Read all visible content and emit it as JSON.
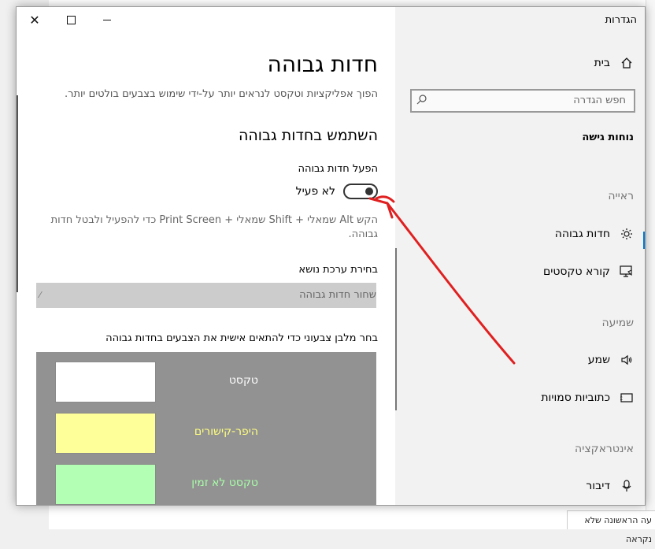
{
  "background": {
    "footer_text": "עה הראשונה שלא נקראה"
  },
  "window": {
    "title": "הגדרות",
    "close_glyph": "✕"
  },
  "nav": {
    "home_label": "בית",
    "search_placeholder": "חפש הגדרה",
    "group_title": "נוחות גישה",
    "categories": {
      "vision": "ראייה",
      "hearing": "שמיעה",
      "interaction": "אינטראקציה"
    },
    "items": {
      "high_contrast": "חדות גבוהה",
      "narrator": "קורא טקסטים",
      "sound": "שמע",
      "captions": "כתוביות סמויות",
      "speech": "דיבור"
    },
    "accent_color": "#0078d7"
  },
  "main": {
    "title": "חדות גבוהה",
    "description": "הפוך אפליקציות וטקסט לנראים יותר על-ידי שימוש בצבעים בולטים יותר.",
    "section_title": "השתמש בחדות גבוהה",
    "toggle_label": "הפעל חדות גבוהה",
    "toggle_state": "לא פעיל",
    "toggle_on": false,
    "hint": "הקש Alt שמאלי + Shift שמאלי + Print Screen כדי להפעיל ולבטל חדות גבוהה.",
    "theme_label": "בחירת ערכת נושא",
    "theme_value": "שחור חדות גבוהה",
    "palette_label": "בחר מלבן צבעוני כדי להתאים אישית את הצבעים בחדות גבוהה",
    "palette": [
      {
        "label": "טקסט",
        "label_color": "#ffffff",
        "swatch_color": "#ffffff"
      },
      {
        "label": "היפר-קישורים",
        "label_color": "#ffff80",
        "swatch_color": "#ffff99"
      },
      {
        "label": "טקסט לא זמין",
        "label_color": "#a8ffa8",
        "swatch_color": "#b3ffb3"
      }
    ]
  },
  "annotation": {
    "color": "#e02020"
  }
}
